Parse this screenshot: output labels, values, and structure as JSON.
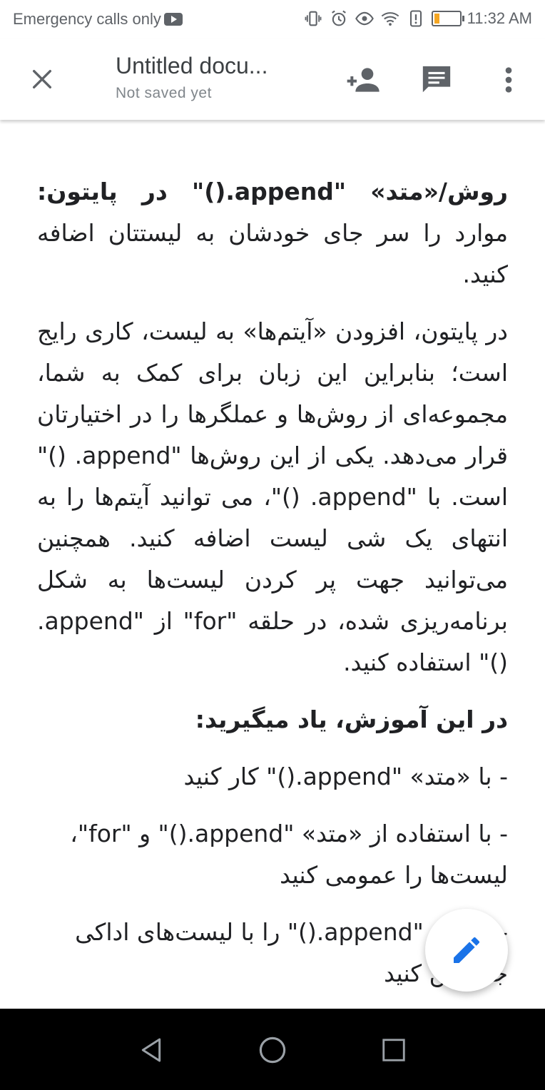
{
  "status_bar": {
    "carrier": "Emergency calls only",
    "time": "11:32 AM",
    "battery_level": 0.2,
    "icons": [
      "youtube-icon",
      "vibrate-icon",
      "alarm-icon",
      "eye-icon",
      "wifi-icon",
      "alert-icon",
      "battery-icon"
    ]
  },
  "app_bar": {
    "title": "Untitled docu...",
    "subtitle": "Not saved yet",
    "icons": [
      "close-icon",
      "add-person-icon",
      "comment-icon",
      "more-vert-icon"
    ]
  },
  "document": {
    "paragraphs": [
      {
        "text": "روش/«متد» \"append.()\" در پایتون: موارد را سر جای خودشان به لیستتان اضافه کنید.",
        "bold_prefix": "روش/«متد» \"append.()\" در پایتون:",
        "rest": " موارد را سر جای خودشان به لیستتان اضافه کنید."
      },
      {
        "text": "در پایتون، افزودن «آیتم‌ها» به لیست، کاری رایج است؛ بنابراین این زبان برای کمک به شما، مجموعه‌ای از روش‌ها و عملگرها را در اختیارتان قرار می‌دهد. یکی از این روش‌ها \"append. ()\" است. با \"append. ()\"، می توانید آیتم‌ها را به انتهای یک شی لیست اضافه کنید. همچنین می‌توانید جهت پر کردن لیست‌ها به شکل برنامه‌ریزی شده، در حلقه \"for\" از \"append. ()\" استفاده کنید."
      },
      {
        "text": "در این آموزش، یاد میگیرید:"
      },
      {
        "text": "- با «متد» \"append.()\" کار کنید"
      },
      {
        "text": "- با استفاده از «متد» \"append.()\" و \"for\"، لیست‌ها را عمومی کنید"
      },
      {
        "text": "- «متد» \"append.()\" را با لیست‌های اداکی جایگزین کنید"
      }
    ]
  },
  "fab": {
    "icon": "edit-pencil-icon"
  },
  "nav_bar": {
    "icons": [
      "back-icon",
      "home-icon",
      "recents-icon"
    ]
  },
  "colors": {
    "accent": "#1a73e8",
    "icon_gray": "#5f6368",
    "text": "#202124",
    "battery": "#f4a623"
  }
}
